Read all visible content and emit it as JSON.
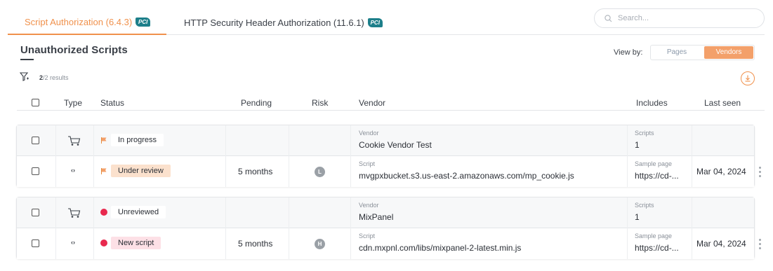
{
  "tabs": [
    {
      "label": "Script Authorization (6.4.3)",
      "badge": "PCI",
      "active": true
    },
    {
      "label": "HTTP Security Header Authorization (11.6.1)",
      "badge": "PCI",
      "active": false
    }
  ],
  "search": {
    "placeholder": "Search..."
  },
  "heading": "Unauthorized Scripts",
  "view_by": {
    "label": "View by:",
    "options": [
      "Pages",
      "Vendors"
    ],
    "selected": "Vendors"
  },
  "results": {
    "count": "2",
    "text": "/2 results"
  },
  "columns": [
    "Type",
    "Status",
    "Pending",
    "Risk",
    "Vendor",
    "Includes",
    "Last seen"
  ],
  "groups": [
    {
      "vendor_row": {
        "status": "In progress",
        "vendor_label": "Vendor",
        "vendor": "Cookie Vendor Test",
        "includes_label": "Scripts",
        "includes": "1"
      },
      "script_row": {
        "status": "Under review",
        "pending": "5 months",
        "risk": "L",
        "script_label": "Script",
        "script": "mvgpxbucket.s3.us-east-2.amazonaws.com/mp_cookie.js",
        "sample_label": "Sample page",
        "sample": "https://cd-...",
        "last_seen": "Mar 04, 2024"
      }
    },
    {
      "vendor_row": {
        "status": "Unreviewed",
        "vendor_label": "Vendor",
        "vendor": "MixPanel",
        "includes_label": "Scripts",
        "includes": "1"
      },
      "script_row": {
        "status": "New script",
        "pending": "5 months",
        "risk": "H",
        "script_label": "Script",
        "script": "cdn.mxpnl.com/libs/mixpanel-2-latest.min.js",
        "sample_label": "Sample page",
        "sample": "https://cd-...",
        "last_seen": "Mar 04, 2024"
      }
    }
  ],
  "colors": {
    "accent": "#f0914c",
    "unreviewed": "#e8294e",
    "pci": "#1d7f8a"
  }
}
